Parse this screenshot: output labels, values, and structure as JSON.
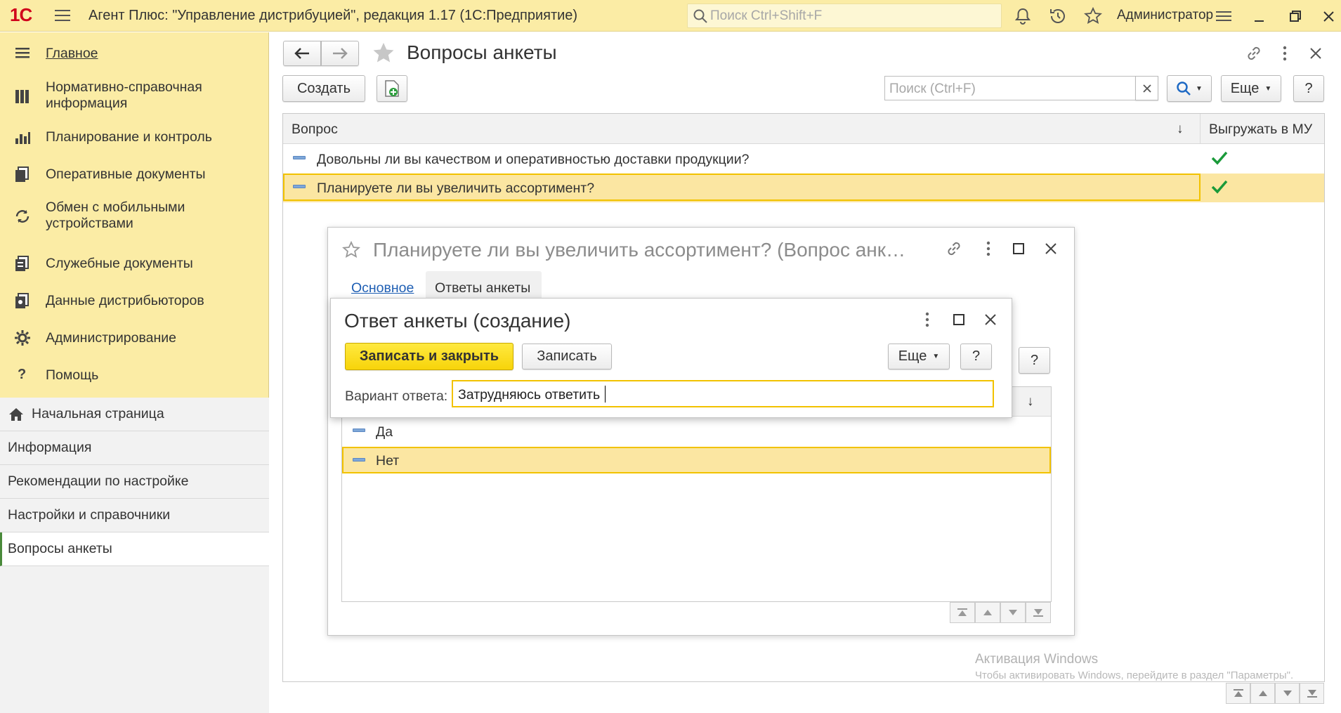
{
  "titlebar": {
    "logo": "1С",
    "title": "Агент Плюс: \"Управление дистрибуцией\", редакция 1.17  (1С:Предприятие)",
    "search_placeholder": "Поиск Ctrl+Shift+F",
    "user": "Администратор"
  },
  "sidebar": {
    "items": [
      {
        "label": "Главное",
        "icon": "menu-lines-icon"
      },
      {
        "label": "Нормативно-справочная информация",
        "icon": "books-icon"
      },
      {
        "label": "Планирование и контроль",
        "icon": "bar-chart-icon"
      },
      {
        "label": "Оперативные документы",
        "icon": "documents-icon"
      },
      {
        "label": "Обмен с мобильными устройствами",
        "icon": "sync-icon"
      },
      {
        "label": "Служебные документы",
        "icon": "service-docs-icon"
      },
      {
        "label": "Данные дистрибьюторов",
        "icon": "distributor-icon"
      },
      {
        "label": "Администрирование",
        "icon": "gear-icon"
      },
      {
        "label": "Помощь",
        "icon": "question-icon"
      }
    ],
    "bottom": [
      {
        "label": "Начальная страница",
        "icon": "home-icon"
      },
      {
        "label": "Информация"
      },
      {
        "label": "Рекомендации по настройке"
      },
      {
        "label": "Настройки и справочники"
      },
      {
        "label": "Вопросы анкеты",
        "active": true
      }
    ]
  },
  "main": {
    "title": "Вопросы анкеты",
    "create_label": "Создать",
    "search_placeholder": "Поиск (Ctrl+F)",
    "more_label": "Еще",
    "help_label": "?",
    "columns": {
      "question": "Вопрос",
      "sort_arrow": "↓",
      "export": "Выгружать в МУ"
    },
    "rows": [
      {
        "question": "Довольны ли вы качеством и оперативностью доставки продукции?",
        "export": true
      },
      {
        "question": "Планируете ли вы увеличить ассортимент?",
        "export": true,
        "selected": true
      }
    ]
  },
  "question_dialog": {
    "title": "Планируете ли вы увеличить ассортимент? (Вопрос анк…",
    "tabs": [
      "Основное",
      "Ответы анкеты"
    ],
    "help_label": "?",
    "sort_arrow": "↓",
    "answers": [
      {
        "label": "Да"
      },
      {
        "label": "Нет",
        "selected": true
      }
    ]
  },
  "answer_dialog": {
    "title": "Ответ анкеты (создание)",
    "save_close_label": "Записать и закрыть",
    "save_label": "Записать",
    "more_label": "Еще",
    "help_label": "?",
    "field_label": "Вариант ответа:",
    "field_value": "Затрудняюсь ответить"
  },
  "watermark": {
    "title": "Активация Windows",
    "text": "Чтобы активировать Windows, перейдите в раздел \"Параметры\"."
  },
  "colors": {
    "accent_yellow": "#fbeca5",
    "selected_row": "#fbe6a2",
    "check_green": "#1a9a3a",
    "link_blue": "#1f5fb4"
  }
}
